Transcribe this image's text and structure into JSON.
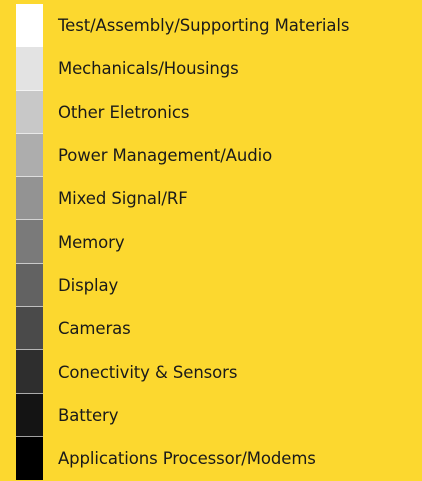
{
  "legend": {
    "items": [
      {
        "label": "Test/Assembly/Supporting Materials",
        "color": "#ffffff"
      },
      {
        "label": "Mechanicals/Housings",
        "color": "#e3e3e3"
      },
      {
        "label": "Other Eletronics",
        "color": "#c8c8c8"
      },
      {
        "label": "Power Management/Audio",
        "color": "#adadad"
      },
      {
        "label": "Mixed Signal/RF",
        "color": "#939393"
      },
      {
        "label": "Memory",
        "color": "#7a7a7a"
      },
      {
        "label": "Display",
        "color": "#626262"
      },
      {
        "label": "Cameras",
        "color": "#4a4a4a"
      },
      {
        "label": "Conectivity & Sensors",
        "color": "#2e2e2e"
      },
      {
        "label": "Battery",
        "color": "#141414"
      },
      {
        "label": "Applications Processor/Modems",
        "color": "#000000"
      }
    ]
  }
}
